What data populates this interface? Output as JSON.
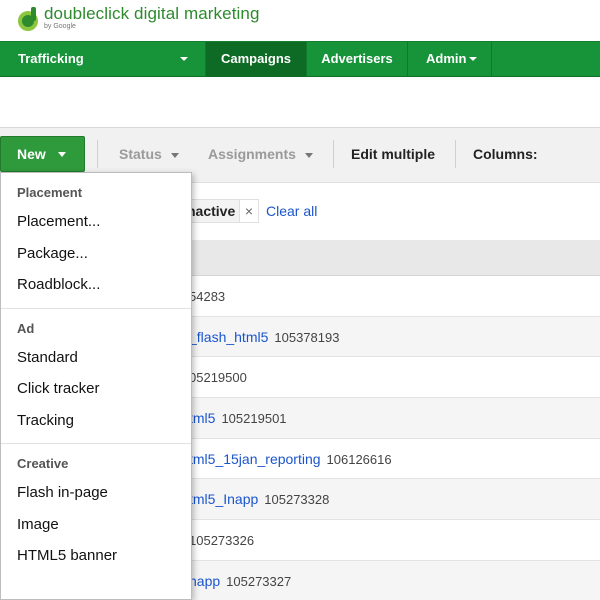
{
  "header": {
    "logo_text": "doubleclick digital marketing",
    "logo_sub": "by Google"
  },
  "nav": {
    "items": [
      {
        "label": "Trafficking"
      },
      {
        "label": "Campaigns"
      },
      {
        "label": "Advertisers"
      },
      {
        "label": "Admin"
      }
    ]
  },
  "toolbar": {
    "new_label": "New",
    "status_label": "Status",
    "assignments_label": "Assignments",
    "edit_multiple_label": "Edit multiple",
    "columns_label": "Columns: Placemen"
  },
  "filter": {
    "chip_label": "nactive",
    "chip_close": "×",
    "clear_all": "Clear all"
  },
  "rows": [
    {
      "name": "",
      "id": "54283"
    },
    {
      "name": "_flash_html5",
      "id": "105378193"
    },
    {
      "name": "",
      "id": "05219500"
    },
    {
      "name": "tml5",
      "id": "105219501"
    },
    {
      "name": "tml5_15jan_reporting",
      "id": "106126616"
    },
    {
      "name": "tml5_Inapp",
      "id": "105273328"
    },
    {
      "name": "",
      "id": "105273326"
    },
    {
      "name": "napp",
      "id": "105273327"
    }
  ],
  "menu": {
    "groups": [
      {
        "header": "Placement",
        "items": [
          "Placement...",
          "Package...",
          "Roadblock..."
        ]
      },
      {
        "header": "Ad",
        "items": [
          "Standard",
          "Click tracker",
          "Tracking"
        ]
      },
      {
        "header": "Creative",
        "items": [
          "Flash in-page",
          "Image",
          "HTML5 banner"
        ]
      }
    ]
  },
  "colors": {
    "brand_green": "#17933a",
    "link_blue": "#1a55cc"
  }
}
